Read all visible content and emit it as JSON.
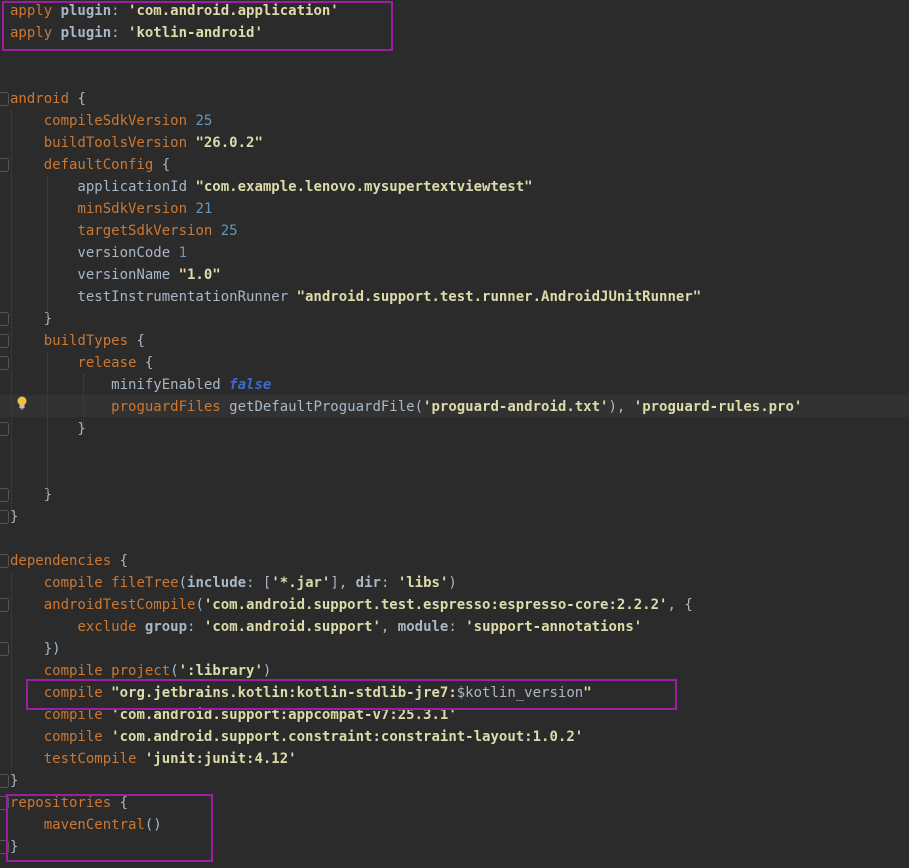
{
  "editor": {
    "lines": [
      {
        "parts": [
          [
            "k",
            "apply "
          ],
          [
            "b",
            "plugin"
          ],
          [
            "pl",
            ": "
          ],
          [
            "str",
            "'com.android.application'"
          ]
        ]
      },
      {
        "parts": [
          [
            "k",
            "apply "
          ],
          [
            "b",
            "plugin"
          ],
          [
            "pl",
            ": "
          ],
          [
            "str",
            "'kotlin-android'"
          ]
        ]
      },
      {
        "parts": []
      },
      {
        "parts": []
      },
      {
        "parts": [
          [
            "k",
            "android"
          ],
          [
            "pl",
            " {"
          ]
        ]
      },
      {
        "parts": [
          [
            "pl",
            "    "
          ],
          [
            "k",
            "compileSdkVersion"
          ],
          [
            "pl",
            " "
          ],
          [
            "n",
            "25"
          ]
        ]
      },
      {
        "parts": [
          [
            "pl",
            "    "
          ],
          [
            "k",
            "buildToolsVersion"
          ],
          [
            "pl",
            " "
          ],
          [
            "str",
            "\"26.0.2\""
          ]
        ]
      },
      {
        "parts": [
          [
            "pl",
            "    "
          ],
          [
            "k",
            "defaultConfig"
          ],
          [
            "pl",
            " {"
          ]
        ]
      },
      {
        "parts": [
          [
            "pl",
            "        applicationId "
          ],
          [
            "str",
            "\"com.example.lenovo.mysupertextviewtest\""
          ]
        ]
      },
      {
        "parts": [
          [
            "pl",
            "        "
          ],
          [
            "k",
            "minSdkVersion"
          ],
          [
            "pl",
            " "
          ],
          [
            "n",
            "21"
          ]
        ]
      },
      {
        "parts": [
          [
            "pl",
            "        "
          ],
          [
            "k",
            "targetSdkVersion"
          ],
          [
            "pl",
            " "
          ],
          [
            "n",
            "25"
          ]
        ]
      },
      {
        "parts": [
          [
            "pl",
            "        versionCode "
          ],
          [
            "n",
            "1"
          ]
        ]
      },
      {
        "parts": [
          [
            "pl",
            "        versionName "
          ],
          [
            "str",
            "\"1.0\""
          ]
        ]
      },
      {
        "parts": [
          [
            "pl",
            "        testInstrumentationRunner "
          ],
          [
            "str",
            "\"android.support.test.runner.AndroidJUnitRunner\""
          ]
        ]
      },
      {
        "parts": [
          [
            "pl",
            "    }"
          ]
        ]
      },
      {
        "parts": [
          [
            "pl",
            "    "
          ],
          [
            "k",
            "buildTypes"
          ],
          [
            "pl",
            " {"
          ]
        ]
      },
      {
        "parts": [
          [
            "pl",
            "        "
          ],
          [
            "k",
            "release"
          ],
          [
            "pl",
            " {"
          ]
        ]
      },
      {
        "parts": [
          [
            "pl",
            "            minifyEnabled "
          ],
          [
            "kw",
            "false"
          ]
        ]
      },
      {
        "parts": [
          [
            "pl",
            "            "
          ],
          [
            "k",
            "proguardFiles"
          ],
          [
            "pl",
            " getDefaultProguardFile("
          ],
          [
            "str",
            "'proguard-android.txt'"
          ],
          [
            "pl",
            "), "
          ],
          [
            "str",
            "'proguard-rules.pro'"
          ]
        ]
      },
      {
        "parts": [
          [
            "pl",
            "        }"
          ]
        ]
      },
      {
        "parts": []
      },
      {
        "parts": []
      },
      {
        "parts": [
          [
            "pl",
            "    }"
          ]
        ]
      },
      {
        "parts": [
          [
            "pl",
            "}"
          ]
        ]
      },
      {
        "parts": []
      },
      {
        "parts": [
          [
            "k",
            "dependencies"
          ],
          [
            "pl",
            " {"
          ]
        ]
      },
      {
        "parts": [
          [
            "pl",
            "    "
          ],
          [
            "k",
            "compile"
          ],
          [
            "pl",
            " "
          ],
          [
            "k",
            "fileTree"
          ],
          [
            "pl",
            "("
          ],
          [
            "b",
            "include"
          ],
          [
            "pl",
            ": ["
          ],
          [
            "str",
            "'*.jar'"
          ],
          [
            "pl",
            "], "
          ],
          [
            "b",
            "dir"
          ],
          [
            "pl",
            ": "
          ],
          [
            "str",
            "'libs'"
          ],
          [
            "pl",
            ")"
          ]
        ]
      },
      {
        "parts": [
          [
            "pl",
            "    "
          ],
          [
            "k",
            "androidTestCompile"
          ],
          [
            "pl",
            "("
          ],
          [
            "str",
            "'com.android.support.test.espresso:espresso-core:2.2.2'"
          ],
          [
            "pl",
            ", {"
          ]
        ]
      },
      {
        "parts": [
          [
            "pl",
            "        "
          ],
          [
            "k",
            "exclude"
          ],
          [
            "pl",
            " "
          ],
          [
            "b",
            "group"
          ],
          [
            "pl",
            ": "
          ],
          [
            "str",
            "'com.android.support'"
          ],
          [
            "pl",
            ", "
          ],
          [
            "b",
            "module"
          ],
          [
            "pl",
            ": "
          ],
          [
            "str",
            "'support-annotations'"
          ]
        ]
      },
      {
        "parts": [
          [
            "pl",
            "    })"
          ]
        ]
      },
      {
        "parts": [
          [
            "pl",
            "    "
          ],
          [
            "k",
            "compile"
          ],
          [
            "pl",
            " "
          ],
          [
            "k",
            "project"
          ],
          [
            "pl",
            "("
          ],
          [
            "str",
            "':library'"
          ],
          [
            "pl",
            ")"
          ]
        ]
      },
      {
        "parts": [
          [
            "pl",
            "    "
          ],
          [
            "k",
            "compile"
          ],
          [
            "pl",
            " "
          ],
          [
            "str",
            "\"org.jetbrains.kotlin:kotlin-stdlib-jre7:"
          ],
          [
            "pl",
            "$kotlin_version"
          ],
          [
            "str",
            "\""
          ]
        ]
      },
      {
        "parts": [
          [
            "pl",
            "    "
          ],
          [
            "k",
            "compile"
          ],
          [
            "pl",
            " "
          ],
          [
            "str",
            "'com.android.support:appcompat-v7:25.3.1'"
          ]
        ]
      },
      {
        "parts": [
          [
            "pl",
            "    "
          ],
          [
            "k",
            "compile"
          ],
          [
            "pl",
            " "
          ],
          [
            "str",
            "'com.android.support.constraint:constraint-layout:1.0.2'"
          ]
        ]
      },
      {
        "parts": [
          [
            "pl",
            "    "
          ],
          [
            "k",
            "testCompile"
          ],
          [
            "pl",
            " "
          ],
          [
            "str",
            "'junit:junit:4.12'"
          ]
        ]
      },
      {
        "parts": [
          [
            "pl",
            "}"
          ]
        ]
      },
      {
        "parts": [
          [
            "k",
            "repositories"
          ],
          [
            "pl",
            " {"
          ]
        ]
      },
      {
        "parts": [
          [
            "pl",
            "    "
          ],
          [
            "k",
            "mavenCentral"
          ],
          [
            "pl",
            "()"
          ]
        ]
      },
      {
        "parts": [
          [
            "pl",
            "}"
          ]
        ]
      }
    ]
  },
  "colors": {
    "background": "#2b2b2b",
    "highlight_box": "#9b1fa0",
    "keyword": "#cc7832",
    "string": "#dcdcaa",
    "number": "#6897bb"
  },
  "icons": {
    "intention_bulb": "lightbulb-icon"
  }
}
